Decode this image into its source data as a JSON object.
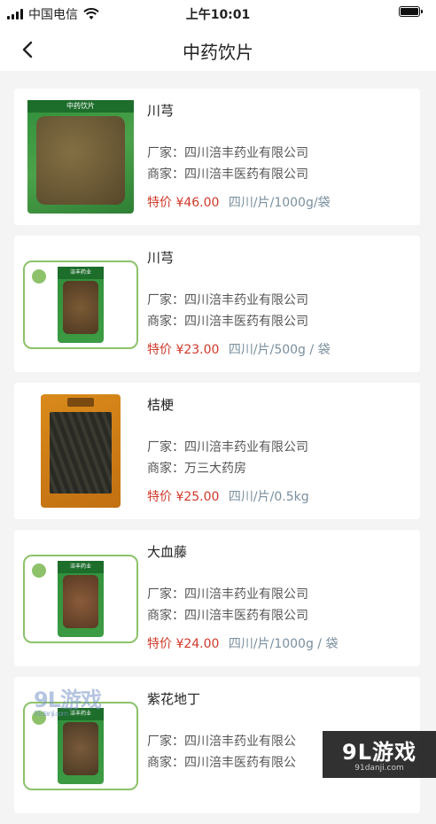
{
  "status_bar": {
    "carrier": "中国电信",
    "time": "上午10:01"
  },
  "header": {
    "title": "中药饮片"
  },
  "labels": {
    "manufacturer": "厂家：",
    "merchant": "商家：",
    "special_price": "特价"
  },
  "products": [
    {
      "name": "川芎",
      "manufacturer": "四川涪丰药业有限公司",
      "merchant": "四川涪丰医药有限公司",
      "price": "¥46.00",
      "spec": "四川/片/1000g/袋",
      "package_text": "中药饮片"
    },
    {
      "name": "川芎",
      "manufacturer": "四川涪丰药业有限公司",
      "merchant": "四川涪丰医药有限公司",
      "price": "¥23.00",
      "spec": "四川/片/500g / 袋",
      "package_text": "涪丰药业"
    },
    {
      "name": "桔梗",
      "manufacturer": "四川涪丰药业有限公司",
      "merchant": "万三大药房",
      "price": "¥25.00",
      "spec": "四川/片/0.5kg",
      "package_text": ""
    },
    {
      "name": "大血藤",
      "manufacturer": "四川涪丰药业有限公司",
      "merchant": "四川涪丰医药有限公司",
      "price": "¥24.00",
      "spec": "四川/片/1000g / 袋",
      "package_text": "涪丰药业"
    },
    {
      "name": "紫花地丁",
      "manufacturer": "四川涪丰药业有限公",
      "merchant": "四川涪丰医药有限公",
      "price": "",
      "spec": "",
      "package_text": "涪丰药业"
    }
  ],
  "watermarks": {
    "left_main": "9L游戏",
    "left_sub": "91danji.com",
    "right_main": "9L游戏",
    "right_sub": "91danji.com"
  },
  "colors": {
    "price": "#d0392b",
    "spec": "#7a8f9e",
    "frame_green": "#8dc26a",
    "background": "#f4f4f4"
  }
}
